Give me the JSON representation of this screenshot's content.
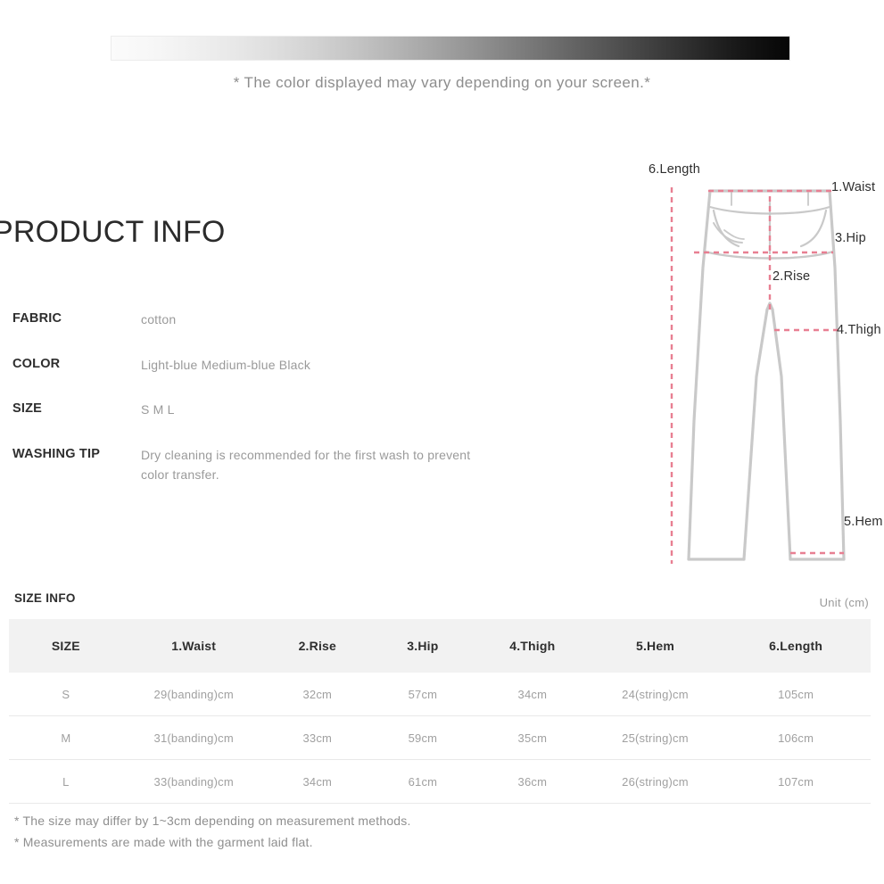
{
  "color_bar": {
    "note": "* The color displayed may vary depending on your screen.*",
    "gradient_from": "#fbfbfb",
    "gradient_to": "#060606"
  },
  "product_info": {
    "title": "PRODUCT INFO",
    "rows": [
      {
        "key": "FABRIC",
        "value": "cotton"
      },
      {
        "key": "COLOR",
        "value": "Light-blue Medium-blue Black"
      },
      {
        "key": "SIZE",
        "value": "S M L"
      },
      {
        "key": "WASHING TIP",
        "value": "Dry cleaning is recommended for the first wash to prevent color transfer."
      }
    ]
  },
  "diagram": {
    "labels": {
      "length": "6.Length",
      "waist": "1.Waist",
      "hip": "3.Hip",
      "rise": "2.Rise",
      "thigh": "4.Thigh",
      "hem": "5.Hem"
    },
    "outline_color": "#c9c9c9",
    "measure_line_color": "#e87f92"
  },
  "size_info": {
    "title": "SIZE INFO",
    "unit": "Unit (cm)",
    "columns": [
      "SIZE",
      "1.Waist",
      "2.Rise",
      "3.Hip",
      "4.Thigh",
      "5.Hem",
      "6.Length"
    ],
    "rows": [
      {
        "size": "S",
        "waist": "29(banding)cm",
        "rise": "32cm",
        "hip": "57cm",
        "thigh": "34cm",
        "hem": "24(string)cm",
        "length": "105cm"
      },
      {
        "size": "M",
        "waist": "31(banding)cm",
        "rise": "33cm",
        "hip": "59cm",
        "thigh": "35cm",
        "hem": "25(string)cm",
        "length": "106cm"
      },
      {
        "size": "L",
        "waist": "33(banding)cm",
        "rise": "34cm",
        "hip": "61cm",
        "thigh": "36cm",
        "hem": "26(string)cm",
        "length": "107cm"
      }
    ],
    "footnotes": [
      "* The size may differ by 1~3cm depending on measurement methods.",
      "* Measurements are made with the garment laid flat."
    ]
  }
}
